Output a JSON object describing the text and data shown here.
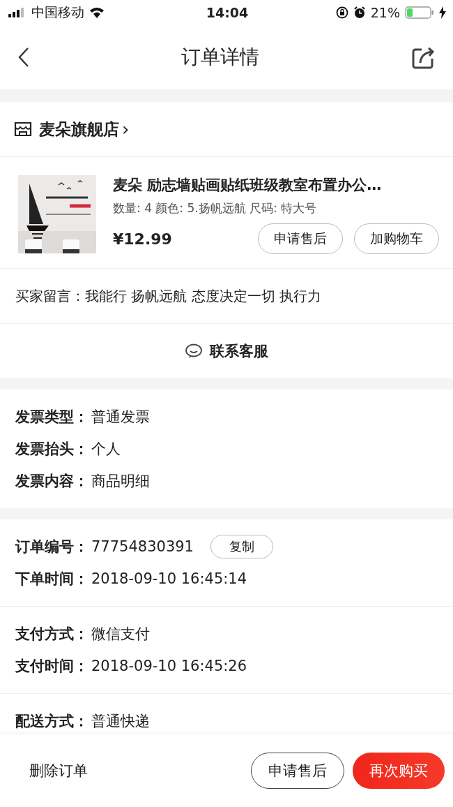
{
  "status_bar": {
    "carrier": "中国移动",
    "time": "14:04",
    "battery": "21%"
  },
  "nav": {
    "title": "订单详情"
  },
  "shop": {
    "name": "麦朵旗舰店",
    "chevron": "›"
  },
  "product": {
    "title": "麦朵 励志墙贴画贴纸班级教室布置办公…",
    "spec": "数量: 4 颜色: 5.扬帆远航 尺码: 特大号",
    "price": "¥12.99",
    "buttons": [
      "申请售后",
      "加购物车"
    ],
    "image": {
      "kind": "picture"
    }
  },
  "message": {
    "label": "买家留言：",
    "text": "我能行 扬帆远航 态度决定一切 执行力"
  },
  "contact": {
    "label": "联系客服"
  },
  "sections": [
    {
      "groups": [
        {
          "rows": [
            {
              "label": "发票类型：",
              "value": "普通发票"
            },
            {
              "label": "发票抬头：",
              "value": "个人"
            },
            {
              "label": "发票内容：",
              "value": "商品明细"
            }
          ]
        }
      ]
    },
    {
      "groups": [
        {
          "rows": [
            {
              "label": "订单编号：",
              "value": "77754830391",
              "action": "复制"
            },
            {
              "label": "下单时间：",
              "value": "2018-09-10 16:45:14"
            }
          ]
        },
        {
          "rows": [
            {
              "label": "支付方式：",
              "value": "微信支付"
            },
            {
              "label": "支付时间：",
              "value": "2018-09-10 16:45:26"
            }
          ]
        },
        {
          "rows": [
            {
              "label": "配送方式：",
              "value": "普通快递"
            }
          ]
        }
      ]
    }
  ],
  "bottom_bar": {
    "delete": "删除订单",
    "buttons": [
      {
        "label": "申请售后",
        "kind": "outline"
      },
      {
        "label": "再次购买",
        "kind": "primary"
      }
    ]
  }
}
